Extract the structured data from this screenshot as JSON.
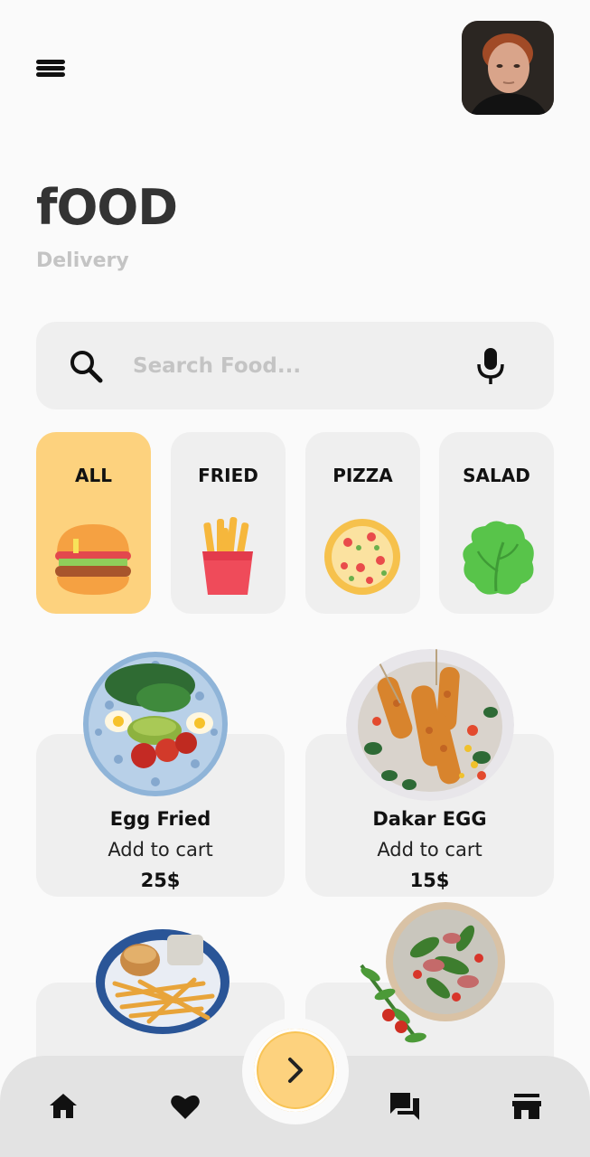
{
  "header": {
    "menu_icon": "hamburger-menu-icon",
    "avatar": "user-avatar-photo"
  },
  "hero": {
    "title": "fOOD",
    "subtitle": "Delivery"
  },
  "search": {
    "placeholder": "Search Food...",
    "value": "",
    "search_icon": "search-icon",
    "mic_icon": "microphone-icon"
  },
  "categories": [
    {
      "label": "ALL",
      "icon": "burger-icon",
      "active": true
    },
    {
      "label": "FRIED",
      "icon": "fries-icon",
      "active": false
    },
    {
      "label": "PIZZA",
      "icon": "pizza-icon",
      "active": false
    },
    {
      "label": "SALAD",
      "icon": "lettuce-icon",
      "active": false
    }
  ],
  "foods": [
    {
      "name": "Egg Fried",
      "action": "Add to cart",
      "price": "25$"
    },
    {
      "name": "Dakar EGG",
      "action": "Add to cart",
      "price": "15$"
    }
  ],
  "bottom_nav": {
    "items": [
      "home-icon",
      "heart-icon",
      "chat-icon",
      "store-icon"
    ],
    "fab_icon": "chevron-right-icon"
  },
  "colors": {
    "accent": "#fdd27e",
    "background": "#fafafa",
    "card": "#efefef",
    "placeholder": "#c4c4c4"
  }
}
